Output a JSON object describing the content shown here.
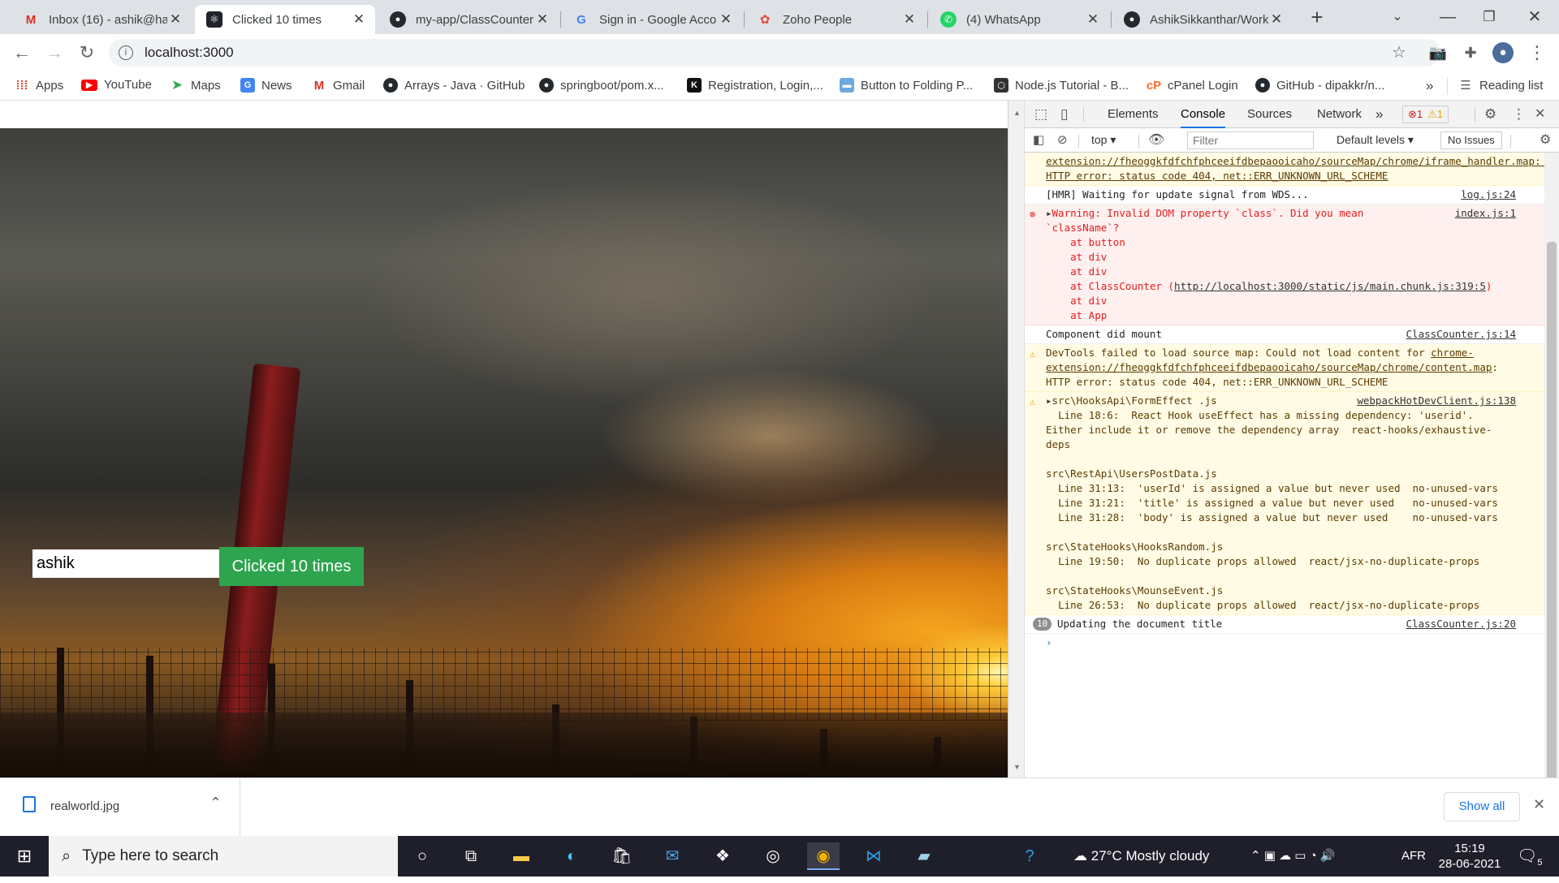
{
  "browser": {
    "tabs": [
      {
        "title": "Inbox (16) - ashik@ha",
        "icon": "gmail-icon",
        "color": "#d93025"
      },
      {
        "title": "Clicked 10 times",
        "icon": "react-icon",
        "color": "#61dafb"
      },
      {
        "title": "my-app/ClassCounter",
        "icon": "github-icon",
        "color": "#000000"
      },
      {
        "title": "Sign in - Google Acco",
        "icon": "google-icon",
        "color": "#4285f4"
      },
      {
        "title": "Zoho People",
        "icon": "zoho-icon",
        "color": "#e94a35"
      },
      {
        "title": "(4) WhatsApp",
        "icon": "whatsapp-icon",
        "color": "#25d366"
      },
      {
        "title": "AshikSikkanthar/Work",
        "icon": "github-icon",
        "color": "#000000"
      }
    ],
    "url": "localhost:3000",
    "bookmarks": [
      {
        "label": "Apps",
        "icon": "apps-grid-icon",
        "color": "#4285f4"
      },
      {
        "label": "YouTube",
        "icon": "youtube-icon",
        "color": "#ff0000"
      },
      {
        "label": "Maps",
        "icon": "maps-icon",
        "color": "#34a853"
      },
      {
        "label": "News",
        "icon": "news-icon",
        "color": "#4285f4"
      },
      {
        "label": "Gmail",
        "icon": "gmail-icon",
        "color": "#d93025"
      },
      {
        "label": "Arrays - Java · GitHub",
        "icon": "github-icon",
        "color": "#000000"
      },
      {
        "label": "springboot/pom.x...",
        "icon": "github-icon",
        "color": "#000000"
      },
      {
        "label": "Registration, Login,...",
        "icon": "k-icon",
        "color": "#000000"
      },
      {
        "label": "Button to Folding P...",
        "icon": "image-icon",
        "color": "#6fa8dc"
      },
      {
        "label": "Node.js Tutorial - B...",
        "icon": "nodejs-icon",
        "color": "#333333"
      },
      {
        "label": "cPanel Login",
        "icon": "cpanel-icon",
        "color": "#ff6c2c"
      },
      {
        "label": "GitHub - dipakkr/n...",
        "icon": "github-icon",
        "color": "#000000"
      }
    ],
    "reading_list": "Reading list"
  },
  "app": {
    "input_value": "ashik",
    "button_label": "Clicked 10 times",
    "button_color": "#2ea44f"
  },
  "devtools": {
    "tabs": [
      "Elements",
      "Console",
      "Sources",
      "Network"
    ],
    "active_tab": "Console",
    "error_count": "1",
    "warning_count": "1",
    "context": "top",
    "filter_placeholder": "Filter",
    "levels": "Default levels",
    "issues": "No Issues",
    "messages": {
      "m0": {
        "text": "extension://fheoggkfdfchfphceeifdbepaooicaho/sourceMap/chrome/iframe_handler.map: HTTP error: status code 404, net::ERR_UNKNOWN_URL_SCHEME"
      },
      "m1": {
        "text": "[HMR] Waiting for update signal from WDS...",
        "source": "log.js:24"
      },
      "m2": {
        "text": "Warning: Invalid DOM property `class`. Did you mean\n`className`?\n    at button\n    at div\n    at div\n    at ClassCounter (",
        "link": "http://localhost:3000/static/js/main.chunk.js:319:5",
        "text_after": ")\n    at div\n    at App",
        "source": "index.js:1"
      },
      "m3": {
        "text": "Component did mount",
        "source": "ClassCounter.js:14"
      },
      "m4": {
        "text": "DevTools failed to load source map: Could not load content for ",
        "link": "chrome-extension://fheoggkfdfchfphceeifdbepaooicaho/sourceMap/chrome/content.map",
        "text_after": ": HTTP error: status code 404, net::ERR_UNKNOWN_URL_SCHEME"
      },
      "m5": {
        "text": "src\\HooksApi\\FormEffect .js\n  Line 18:6:  React Hook useEffect has a missing dependency: 'userid'. Either include it or remove the dependency array  react-hooks/exhaustive-deps\n\nsrc\\RestApi\\UsersPostData.js\n  Line 31:13:  'userId' is assigned a value but never used  no-unused-vars\n  Line 31:21:  'title' is assigned a value but never used   no-unused-vars\n  Line 31:28:  'body' is assigned a value but never used    no-unused-vars\n\nsrc\\StateHooks\\HooksRandom.js\n  Line 19:50:  No duplicate props allowed  react/jsx-no-duplicate-props\n\nsrc\\StateHooks\\MounseEvent.js\n  Line 26:53:  No duplicate props allowed  react/jsx-no-duplicate-props",
        "source": "webpackHotDevClient.js:138"
      },
      "m6": {
        "count": "10",
        "text": "Updating the document title",
        "source": "ClassCounter.js:20"
      }
    }
  },
  "downloads": {
    "file": "realworld.jpg",
    "show_all": "Show all"
  },
  "taskbar": {
    "search_placeholder": "Type here to search",
    "weather": "27°C  Mostly cloudy",
    "language": "AFR",
    "time": "15:19",
    "date": "28-06-2021",
    "notification_count": "5"
  }
}
